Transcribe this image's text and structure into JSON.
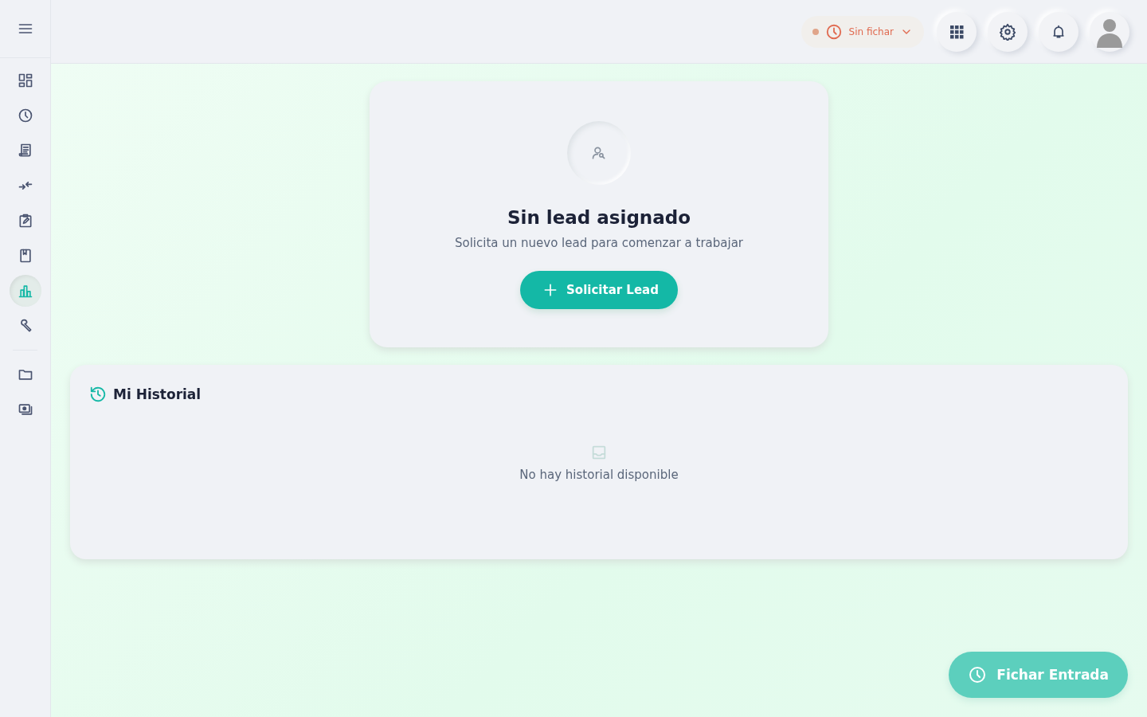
{
  "sidebar": {
    "groups": [
      {
        "items": [
          {
            "selected": false
          },
          {
            "selected": false
          },
          {
            "selected": false
          },
          {
            "selected": false
          },
          {
            "selected": false
          },
          {
            "selected": false
          },
          {
            "selected": true
          },
          {
            "selected": false
          }
        ]
      },
      {
        "items": [
          {
            "selected": false
          },
          {
            "selected": false
          }
        ]
      }
    ]
  },
  "topbar": {
    "status": {
      "label": "Sin fichar"
    }
  },
  "lead_card": {
    "title": "Sin lead asignado",
    "subtitle": "Solicita un nuevo lead para comenzar a trabajar",
    "button": "Solicitar Lead"
  },
  "history": {
    "title": "Mi Historial",
    "empty_message": "No hay historial disponible"
  },
  "clock_button": {
    "label": "Fichar Entrada"
  }
}
